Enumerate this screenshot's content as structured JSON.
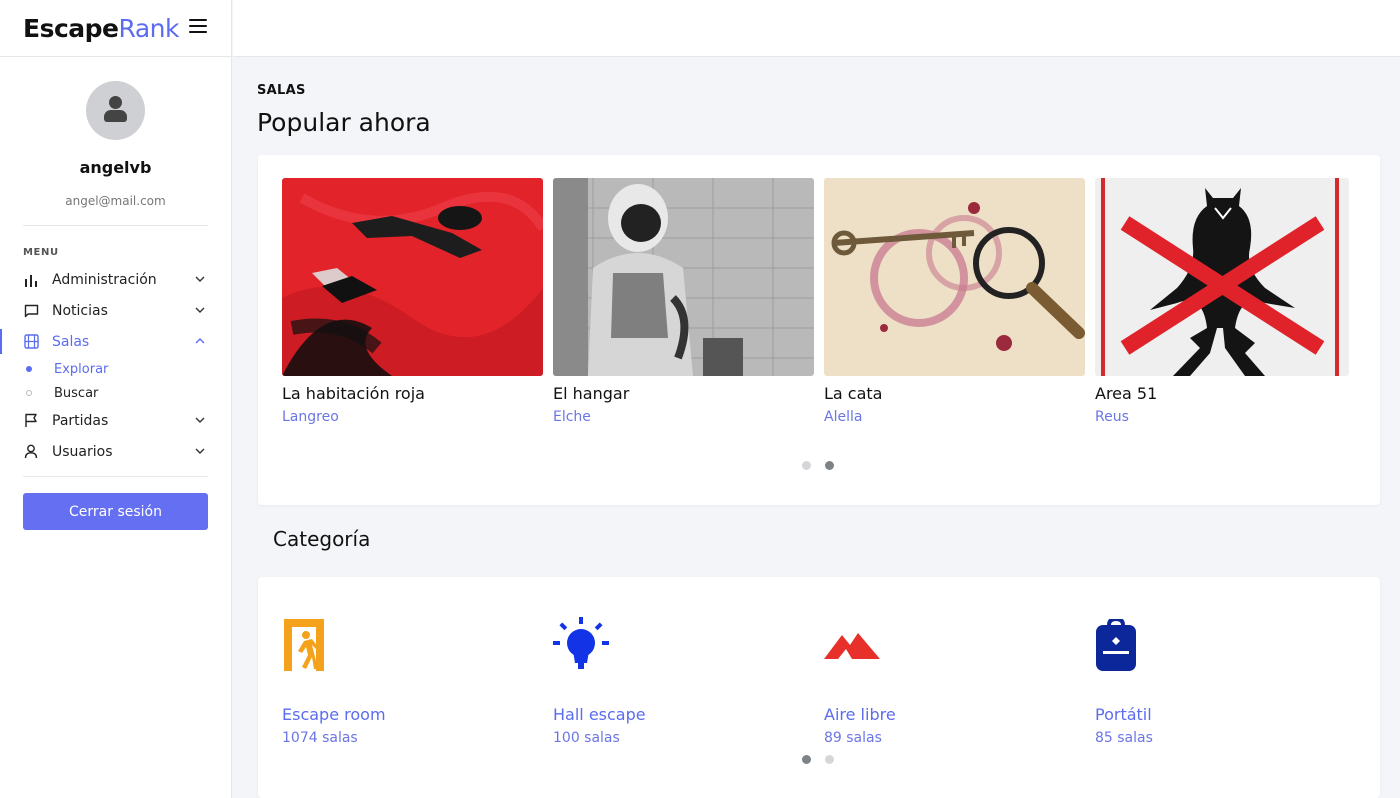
{
  "brand": {
    "part1": "Escape",
    "part2": "Rank"
  },
  "user": {
    "name": "angelvb",
    "email": "angel@mail.com"
  },
  "menu": {
    "label": "MENU",
    "items": [
      {
        "label": "Administración",
        "icon": "bar-chart-icon"
      },
      {
        "label": "Noticias",
        "icon": "chat-icon"
      },
      {
        "label": "Salas",
        "icon": "film-icon"
      },
      {
        "label": "Partidas",
        "icon": "flag-icon"
      },
      {
        "label": "Usuarios",
        "icon": "user-icon"
      }
    ],
    "sub_items": [
      {
        "label": "Explorar"
      },
      {
        "label": "Buscar"
      }
    ],
    "logout_label": "Cerrar sesión"
  },
  "popular": {
    "kicker": "SALAS",
    "title": "Popular ahora",
    "rooms": [
      {
        "name": "La habitación roja",
        "city": "Langreo"
      },
      {
        "name": "El hangar",
        "city": "Elche"
      },
      {
        "name": "La cata",
        "city": "Alella"
      },
      {
        "name": "Area 51",
        "city": "Reus"
      }
    ]
  },
  "categories": {
    "title": "Categoría",
    "items": [
      {
        "name": "Escape room",
        "count": "1074 salas",
        "icon": "exit-door-icon",
        "color": "#f4a21b"
      },
      {
        "name": "Hall escape",
        "count": "100 salas",
        "icon": "lightbulb-icon",
        "color": "#1233e6"
      },
      {
        "name": "Aire libre",
        "count": "89 salas",
        "icon": "mountain-icon",
        "color": "#e8302a"
      },
      {
        "name": "Portátil",
        "count": "85 salas",
        "icon": "backpack-icon",
        "color": "#0c2799"
      }
    ]
  },
  "colors": {
    "accent": "#5b6cf0",
    "button": "#6470f1"
  }
}
